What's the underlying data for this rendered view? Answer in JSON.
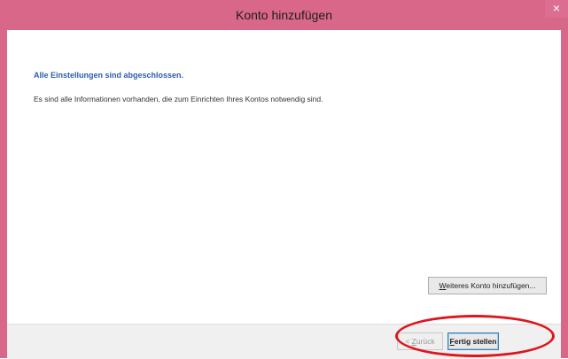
{
  "window": {
    "title": "Konto hinzufügen",
    "close_glyph": "×",
    "accent_color": "#d9678a"
  },
  "content": {
    "heading": "Alle Einstellungen sind abgeschlossen.",
    "description": "Es sind alle Informationen vorhanden, die zum Einrichten Ihres Kontos notwendig sind."
  },
  "buttons": {
    "add_account_mnemonic": "W",
    "add_account_rest": "eiteres Konto hinzufügen...",
    "back_prefix": "< ",
    "back_mnemonic": "Z",
    "back_rest": "urück",
    "finish_mnemonic": "F",
    "finish_rest": "ertig stellen"
  },
  "annotation": {
    "highlight_color": "#e0141c",
    "shape": "ellipse"
  }
}
